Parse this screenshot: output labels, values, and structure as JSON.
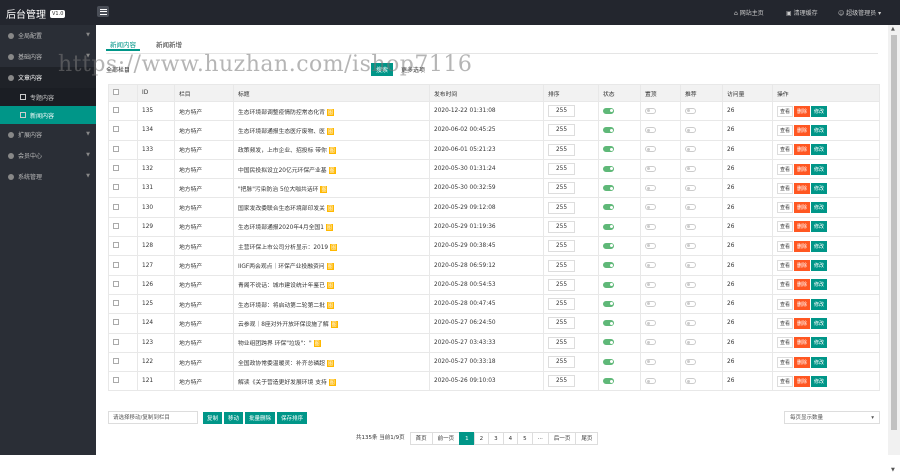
{
  "app": {
    "title": "后台管理",
    "version": "V1.0"
  },
  "topnav": {
    "site_home": "网站主页",
    "clear_cache": "清理缓存",
    "user": "超级管理员"
  },
  "sidebar": {
    "items": [
      {
        "label": "全局配置"
      },
      {
        "label": "基础内容"
      },
      {
        "label": "文章内容"
      },
      {
        "label": "扩展内容"
      },
      {
        "label": "会员中心"
      },
      {
        "label": "系统管理"
      }
    ],
    "subitems": [
      {
        "label": "专题内容"
      },
      {
        "label": "新闻内容"
      }
    ]
  },
  "tabs": [
    {
      "label": "新闻内容"
    },
    {
      "label": "新闻新增"
    }
  ],
  "filter": {
    "category": "全部栏目",
    "search_btn": "搜索",
    "more": "更多选项"
  },
  "watermark": "https://www.huzhan.com/ishop7116",
  "table": {
    "headers": [
      "ID",
      "栏目",
      "标题",
      "发布时间",
      "排序",
      "状态",
      "置顶",
      "推荐",
      "访问量",
      "操作"
    ],
    "rows": [
      {
        "id": "135",
        "cat": "地方特产",
        "title": "生态环境部调整疫情防控常态化背",
        "time": "2020-12-22 01:31:08",
        "sort": "255",
        "views": "26"
      },
      {
        "id": "134",
        "cat": "地方特产",
        "title": "生态环境部通报生态医疗废物、医",
        "time": "2020-06-02 00:45:25",
        "sort": "255",
        "views": "26"
      },
      {
        "id": "133",
        "cat": "地方特产",
        "title": "政策频发，上市企业、招投标 带你",
        "time": "2020-06-01 05:21:23",
        "sort": "255",
        "views": "26"
      },
      {
        "id": "132",
        "cat": "地方特产",
        "title": "中国民投拟设立20亿元环保产业基",
        "time": "2020-05-30 01:31:24",
        "sort": "255",
        "views": "26"
      },
      {
        "id": "131",
        "cat": "地方特产",
        "title": "\"把脉\"污染防治 5位大咖共话环",
        "time": "2020-05-30 00:32:59",
        "sort": "255",
        "views": "26"
      },
      {
        "id": "130",
        "cat": "地方特产",
        "title": "国家发改委联合生态环境部印发关",
        "time": "2020-05-29 09:12:08",
        "sort": "255",
        "views": "26"
      },
      {
        "id": "129",
        "cat": "地方特产",
        "title": "生态环境部通报2020年4月全国1",
        "time": "2020-05-29 01:19:36",
        "sort": "255",
        "views": "26"
      },
      {
        "id": "128",
        "cat": "地方特产",
        "title": "主营环保上市公司分析显示：2019",
        "time": "2020-05-29 00:38:45",
        "sort": "255",
        "views": "26"
      },
      {
        "id": "127",
        "cat": "地方特产",
        "title": "IIGF两会观点｜环保产业投融资问",
        "time": "2020-05-28 06:59:12",
        "sort": "255",
        "views": "26"
      },
      {
        "id": "126",
        "cat": "地方特产",
        "title": "青阁不说话：城市建设统计年鉴已",
        "time": "2020-05-28 00:54:53",
        "sort": "255",
        "views": "26"
      },
      {
        "id": "125",
        "cat": "地方特产",
        "title": "生态环境部：将启动第二轮第二批",
        "time": "2020-05-28 00:47:45",
        "sort": "255",
        "views": "26"
      },
      {
        "id": "124",
        "cat": "地方特产",
        "title": "云参观｜8座对外开放环保设施了解",
        "time": "2020-05-27 06:24:50",
        "sort": "255",
        "views": "26"
      },
      {
        "id": "123",
        "cat": "地方特产",
        "title": "物业组团跨界 环保\"垃圾\"：\"",
        "time": "2020-05-27 03:43:33",
        "sort": "255",
        "views": "26"
      },
      {
        "id": "122",
        "cat": "地方特产",
        "title": "全国政协常委温暖灵：补齐总磷超",
        "time": "2020-05-27 00:33:18",
        "sort": "255",
        "views": "26"
      },
      {
        "id": "121",
        "cat": "地方特产",
        "title": "解读《关于营造更好发展环境 支持",
        "time": "2020-05-26 09:10:03",
        "sort": "255",
        "views": "26"
      }
    ],
    "tag": "图",
    "ops": {
      "view": "查看",
      "del": "删除",
      "edit": "修改"
    }
  },
  "bottom": {
    "select_placeholder": "请选择移动/复制到栏目",
    "copy": "复制",
    "move": "移动",
    "batch_delete": "批量删除",
    "save_sort": "保存排序",
    "per_page": "每页显示数量"
  },
  "pager": {
    "info": "共135条 当前1/9页",
    "first": "首页",
    "prev": "前一页",
    "pages": [
      "1",
      "2",
      "3",
      "4",
      "5",
      "···"
    ],
    "next": "后一页",
    "last": "尾页"
  }
}
